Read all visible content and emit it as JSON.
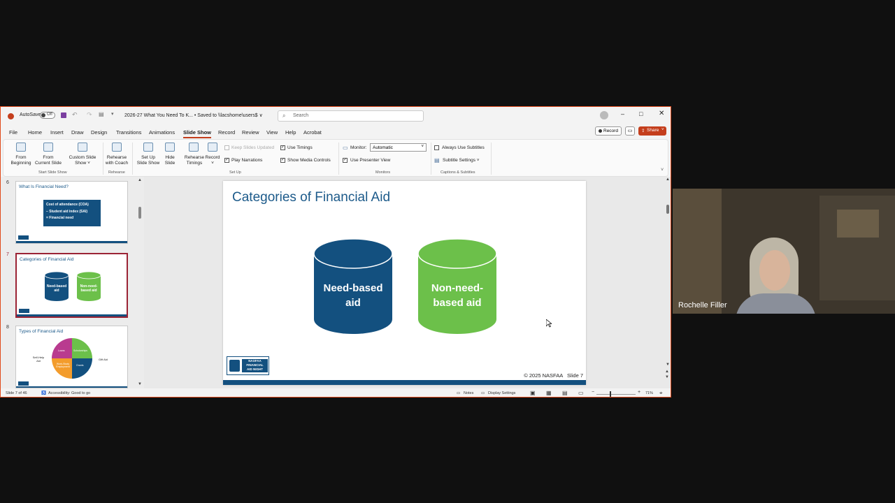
{
  "window": {
    "autosave_label": "AutoSave",
    "autosave_state": "Off",
    "doc_title": "2026-27 What You Need To K... • Saved to \\\\lacshome\\users$ ∨",
    "search_placeholder": "Search"
  },
  "tabs": [
    "File",
    "Home",
    "Insert",
    "Draw",
    "Design",
    "Transitions",
    "Animations",
    "Slide Show",
    "Record",
    "Review",
    "View",
    "Help",
    "Acrobat"
  ],
  "active_tab": "Slide Show",
  "top_right": {
    "record_label": "Record",
    "share_label": "Share"
  },
  "ribbon": {
    "from_beginning": [
      "From",
      "Beginning"
    ],
    "from_current": [
      "From",
      "Current Slide"
    ],
    "custom_show": [
      "Custom Slide",
      "Show ˅"
    ],
    "group_start": "Start Slide Show",
    "rehearse_coach": [
      "Rehearse",
      "with Coach"
    ],
    "group_rehearse": "Rehearse",
    "setup_show": [
      "Set Up",
      "Slide Show"
    ],
    "hide_slide": [
      "Hide",
      "Slide"
    ],
    "rehearse_timings": [
      "Rehearse",
      "Timings"
    ],
    "record": [
      "Record",
      "˅"
    ],
    "keep_updated": "Keep Slides Updated",
    "play_narrations": "Play Narrations",
    "use_timings": "Use Timings",
    "show_media": "Show Media Controls",
    "group_setup": "Set Up",
    "monitor_label": "Monitor:",
    "monitor_value": "Automatic",
    "presenter_view": "Use Presenter View",
    "group_monitors": "Monitors",
    "always_subtitles": "Always Use Subtitles",
    "subtitle_settings": "Subtitle Settings ˅",
    "group_captions": "Captions & Subtitles"
  },
  "thumbnails": [
    {
      "num": "6",
      "title": "What Is Financial Need?",
      "lines": [
        "Cost of attendance (COA)",
        "− Student aid index (SAI)",
        "= Financial need"
      ]
    },
    {
      "num": "7",
      "title": "Categories of Financial Aid",
      "labels": [
        "Need-based aid",
        "Non-need-based aid"
      ]
    },
    {
      "num": "8",
      "title": "Types of Financial Aid",
      "quadrants": [
        "Loans",
        "Scholarships",
        "Work-Study Employment",
        "Grants"
      ],
      "sides": [
        "Self-Help Aid",
        "Gift Aid"
      ]
    }
  ],
  "slide": {
    "title": "Categories of Financial Aid",
    "cyl1": [
      "Need-based",
      "aid"
    ],
    "cyl2": [
      "Non-need-",
      "based aid"
    ],
    "logo": [
      "NASFAA",
      "FINANCIAL",
      "AID NIGHT"
    ],
    "footer": "© 2025 NASFAA   Slide 7"
  },
  "status": {
    "slide_count": "Slide 7 of 46",
    "accessibility": "Accessibility: Good to go",
    "notes": "Notes",
    "display": "Display Settings",
    "zoom": "71%"
  },
  "video": {
    "name": "Rochelle Filler"
  },
  "colors": {
    "accent": "#c43e1c",
    "blue": "#13507f",
    "green": "#6cc04a",
    "title_blue": "#1c5a8a"
  }
}
